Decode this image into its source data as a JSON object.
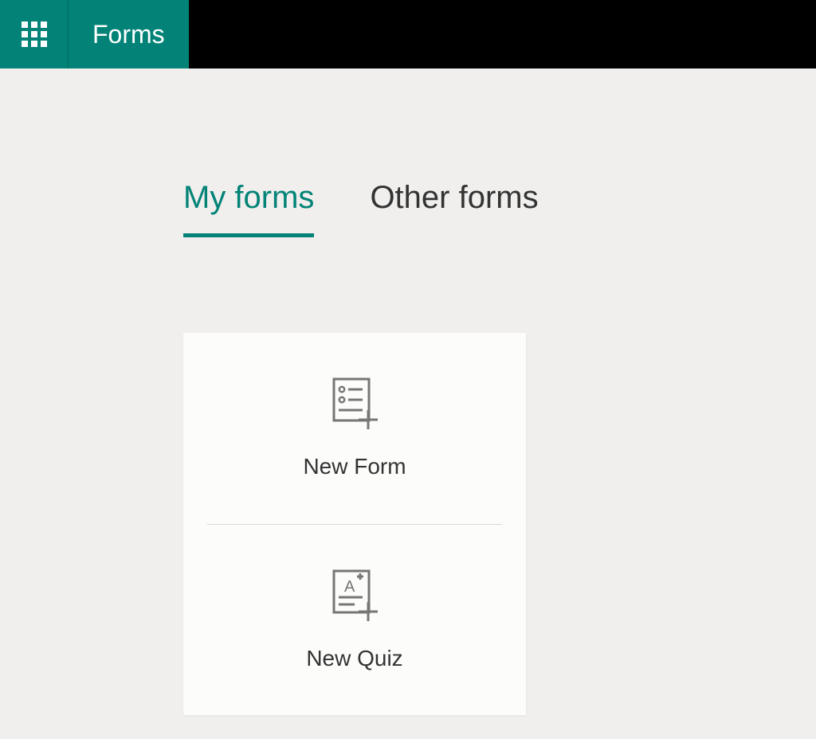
{
  "header": {
    "app_title": "Forms"
  },
  "tabs": {
    "my_forms": "My forms",
    "other_forms": "Other forms"
  },
  "cards": {
    "new_form": "New Form",
    "new_quiz": "New Quiz"
  },
  "colors": {
    "brand": "#038377",
    "header_bg": "#000000",
    "page_bg": "#f0efee",
    "icon": "#767676"
  }
}
